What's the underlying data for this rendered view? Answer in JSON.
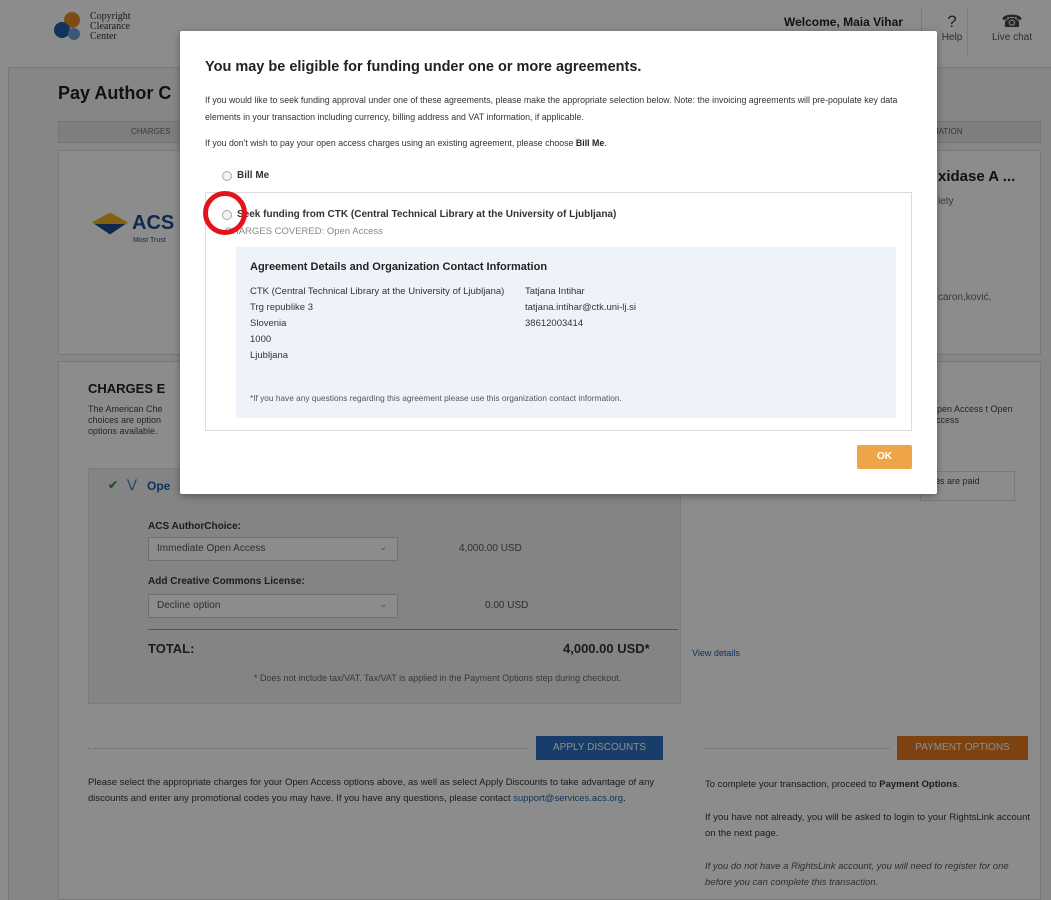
{
  "header": {
    "logo_lines": [
      "Copyright",
      "Clearance",
      "Center"
    ],
    "welcome": "Welcome, Maia Vihar",
    "help_label": "Help",
    "help_glyph": "?",
    "chat_label": "Live chat",
    "chat_glyph": "chat-icon"
  },
  "page": {
    "title": "Pay Author C",
    "steps": [
      "CHARGES",
      "MATION"
    ],
    "journal_logo": "ACS",
    "journal_tagline": "Most Trust",
    "article_title": "xidase A ...",
    "article_society": "iety",
    "article_authors": "caron,ković,",
    "charges_heading": "CHARGES E",
    "charges_text": "The American Che choices are option options available.",
    "charges_right": "Open Access t Open Access",
    "oa_label": "Ope",
    "side_note": "rges are paid",
    "author_choice_label": "ACS AuthorChoice:",
    "author_choice_value": "Immediate Open Access",
    "author_choice_price": "4,000.00 USD",
    "cc_label": "Add Creative Commons License:",
    "cc_value": "Decline option",
    "cc_price": "0.00 USD",
    "total_label": "TOTAL:",
    "total_value": "4,000.00 USD*",
    "view_details": "View details",
    "tax_note": "* Does not include tax/VAT. Tax/VAT is applied in the Payment Options step during checkout.",
    "apply_discounts": "APPLY DISCOUNTS",
    "payment_options": "PAYMENT OPTIONS",
    "bottom_left_text": "Please select the appropriate charges for your Open Access options above, as well as select Apply Discounts to take advantage of any discounts and enter any promotional codes you may have. If you have any questions, please contact ",
    "support_email": "support@services.acs.org",
    "bottom_left_end": ".",
    "bottom_right_1a": "To complete your transaction, proceed to ",
    "bottom_right_1b": "Payment Options",
    "bottom_right_1c": ".",
    "bottom_right_2": "If you have not already, you will be asked to login to your RightsLink account on the next page.",
    "bottom_right_3": "If you do not have a RightsLink account, you will need to register for one before you can complete this transaction."
  },
  "modal": {
    "title": "You may be eligible for funding under one or more agreements.",
    "intro": "If you would like to seek funding approval under one of these agreements, please make the appropriate selection below. Note: the invoicing agreements will pre-populate key data elements in your transaction including currency, billing address and VAT information, if applicable.",
    "bill_me_prompt": "If you don't wish to pay your open access charges using an existing agreement, please choose ",
    "bill_me_bold": "Bill Me",
    "bill_me_end": ".",
    "option_bill_me": "Bill Me",
    "option_ctk": "Seek funding from CTK (Central Technical Library at the University of Ljubljana)",
    "charges_covered": "CHARGES COVERED: Open Access",
    "details_heading": "Agreement Details and Organization Contact Information",
    "org_address": [
      "CTK (Central Technical Library at the University of Ljubljana)",
      "Trg republike 3",
      "Slovenia",
      "1000",
      "Ljubljana"
    ],
    "contact_name": "Tatjana Intihar",
    "contact_email": "tatjana.intihar@ctk.uni-lj.si",
    "contact_phone": "38612003414",
    "details_note": "*If you have any questions regarding this agreement please use this organization contact information.",
    "ok_label": "OK"
  },
  "colors": {
    "highlight_ring": "#e5121b",
    "ok_button": "#f0a448",
    "apply_discounts": "#2c6fc0",
    "payment_options": "#e27a20"
  }
}
